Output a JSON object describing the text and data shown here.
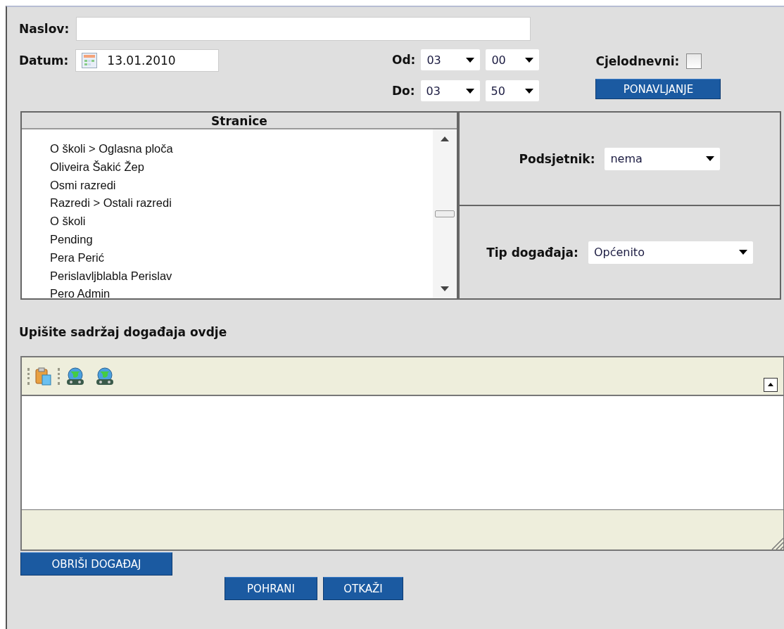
{
  "title_field": {
    "label": "Naslov:"
  },
  "date_field": {
    "label": "Datum:",
    "value": "13.01.2010"
  },
  "time_rows": [
    {
      "label": "Od:",
      "hour": "03",
      "minute": "00"
    },
    {
      "label": "Do:",
      "hour": "03",
      "minute": "50"
    }
  ],
  "all_day": {
    "label": "Cjelodnevni:",
    "checked": false
  },
  "repeat_button": "PONAVLJANJE",
  "pages_list": {
    "header": "Stranice",
    "items": [
      {
        "label": "O školi > Oglasna ploča",
        "selected": false
      },
      {
        "label": "Oliveira Šakić Žep",
        "selected": false
      },
      {
        "label": "Osmi razredi",
        "selected": false
      },
      {
        "label": "Razredi > Ostali razredi",
        "selected": false
      },
      {
        "label": "O školi",
        "selected": false
      },
      {
        "label": "Pending",
        "selected": false
      },
      {
        "label": "Pera Perić",
        "selected": false
      },
      {
        "label": "Perislavljblabla Perislav",
        "selected": false
      },
      {
        "label": "Pero Admin",
        "selected": false
      }
    ]
  },
  "reminder": {
    "label": "Podsjetnik:",
    "value": "nema"
  },
  "event_type": {
    "label": "Tip događaja:",
    "value": "Općenito"
  },
  "content_heading": "Upišite sadržaj događaja ovdje",
  "delete_button": "OBRIŠI DOGAĐAJ",
  "buttons": [
    "POHRANI",
    "OTKAŽI"
  ]
}
